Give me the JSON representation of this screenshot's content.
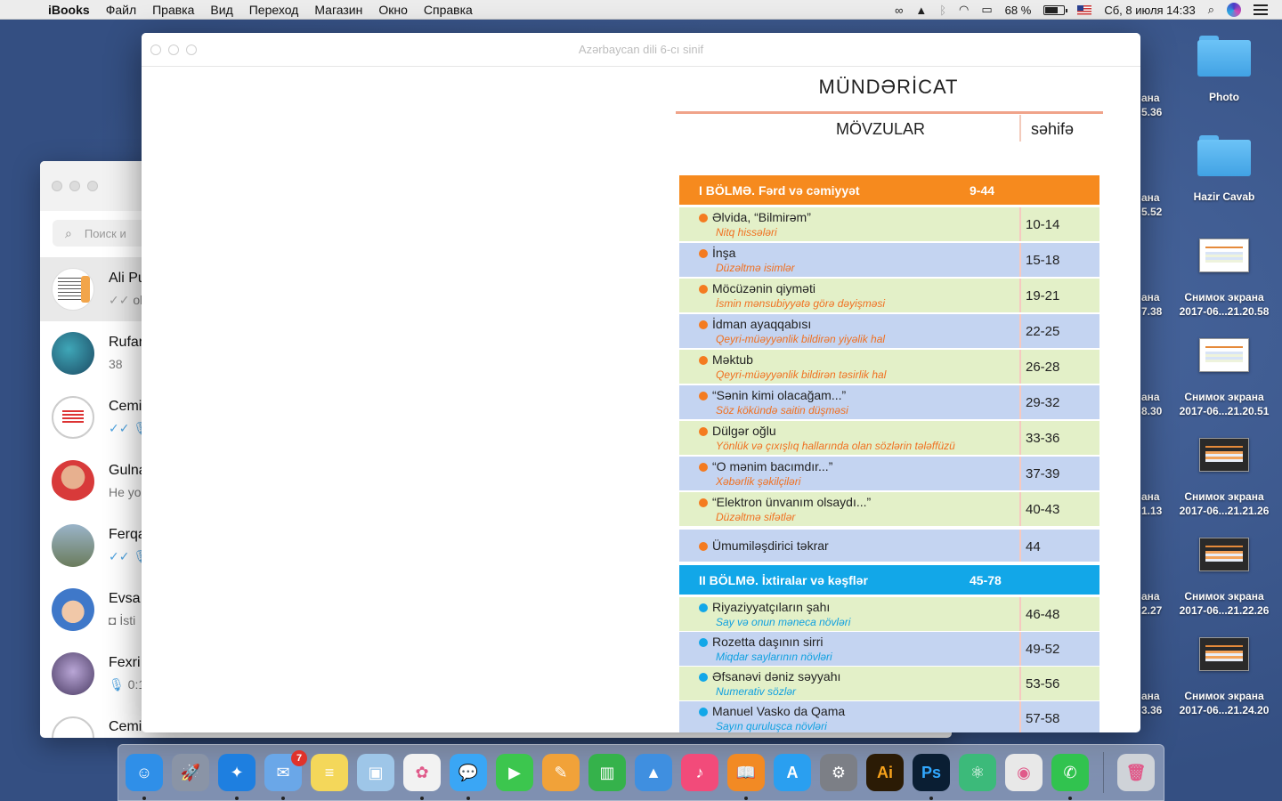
{
  "menubar": {
    "app": "iBooks",
    "items": [
      "Файл",
      "Правка",
      "Вид",
      "Переход",
      "Магазин",
      "Окно",
      "Справка"
    ],
    "battery": "68 %",
    "datetime": "Сб, 8 июля  14:33",
    "battery_level": 0.68
  },
  "desktop": {
    "folders": [
      {
        "label": "Photo"
      },
      {
        "label": "Hazir Cavab"
      }
    ],
    "screenshots": [
      {
        "line1": "Снимок экрана",
        "line2": "2017-06...21.20.58"
      },
      {
        "line1": "Снимок экрана",
        "line2": "2017-06...21.20.51"
      },
      {
        "line1": "Снимок экрана",
        "line2": "2017-06...21.21.26"
      },
      {
        "line1": "Снимок экрана",
        "line2": "2017-06...21.22.26"
      },
      {
        "line1": "Снимок экрана",
        "line2": "2017-06...21.24.20"
      }
    ],
    "cut_labels": [
      {
        "a": "ана",
        "b": "5.36"
      },
      {
        "a": "ана",
        "b": "5.52"
      },
      {
        "a": "ана",
        "b": "7.38"
      },
      {
        "a": "ана",
        "b": "8.30"
      },
      {
        "a": "ана",
        "b": "1.13"
      },
      {
        "a": "ана",
        "b": "2.27"
      },
      {
        "a": "ана",
        "b": "3.36"
      }
    ]
  },
  "messenger": {
    "search_placeholder": "Поиск и",
    "chats": [
      {
        "name": "Ali Pu",
        "preview": "ok"
      },
      {
        "name": "Rufar",
        "preview": "38"
      },
      {
        "name": "Cemi",
        "preview": ""
      },
      {
        "name": "Gulna",
        "preview": "He yo"
      },
      {
        "name": "Ferqa",
        "preview": ""
      },
      {
        "name": "Evsa",
        "preview": "İsti"
      },
      {
        "name": "Fexri",
        "preview": "0:12"
      },
      {
        "name": "Cemi",
        "preview": ""
      }
    ]
  },
  "book": {
    "window_title": "Azərbaycan dili 6-cı sinif",
    "heading": "MÜNDƏRİCAT",
    "col_topics": "MÖVZULAR",
    "col_page": "səhifə",
    "sections": [
      {
        "label": "I BÖLMƏ. Fərd və cəmiyyət",
        "range": "9-44",
        "rows": [
          {
            "topic": "Əlvida, “Bilmirəm”",
            "sub": "Nitq hissələri",
            "pages": "10-14"
          },
          {
            "topic": "İnşa",
            "sub": "Düzəltmə isimlər",
            "pages": "15-18"
          },
          {
            "topic": "Möcüzənin qiyməti",
            "sub": "İsmin mənsubiyyətə görə dəyişməsi",
            "pages": "19-21"
          },
          {
            "topic": "İdman ayaqqabısı",
            "sub": "Qeyri-müəyyənlik bildirən yiyəlik hal",
            "pages": "22-25"
          },
          {
            "topic": "Məktub",
            "sub": "Qeyri-müəyyənlik bildirən təsirlik hal",
            "pages": "26-28"
          },
          {
            "topic": "“Sənin kimi olacağam...”",
            "sub": "Söz kökündə saitin düşməsi",
            "pages": "29-32"
          },
          {
            "topic": "Dülgər oğlu",
            "sub": "Yönlük və çıxışlıq hallarında olan sözlərin tələffüzü",
            "pages": "33-36"
          },
          {
            "topic": "“O mənim bacımdır...”",
            "sub": "Xəbərlik şəkilçiləri",
            "pages": "37-39"
          },
          {
            "topic": "“Elektron ünvanım olsaydı...”",
            "sub": "Düzəltmə sifətlər",
            "pages": "40-43"
          },
          {
            "topic": "Ümumiləşdirici təkrar",
            "sub": "",
            "pages": "44"
          }
        ]
      },
      {
        "label": "II BÖLMƏ. İxtiralar və kəşflər",
        "range": "45-78",
        "rows": [
          {
            "topic": "Riyaziyyatçıların şahı",
            "sub": "Say və onun məneca növləri",
            "pages": "46-48"
          },
          {
            "topic": "Rozetta daşının sirri",
            "sub": "Miqdar saylarının növləri",
            "pages": "49-52"
          },
          {
            "topic": "Əfsanəvi dəniz səyyahı",
            "sub": "Numerativ sözlər",
            "pages": "53-56"
          },
          {
            "topic": "Manuel Vasko da Qama",
            "sub": "Sayın quruluşca növləri",
            "pages": "57-58"
          }
        ]
      }
    ]
  },
  "dock": {
    "apps": [
      {
        "icon": "finder-icon",
        "color": "#2f8fe8"
      },
      {
        "icon": "launchpad-icon",
        "color": "#8a94a6"
      },
      {
        "icon": "safari-icon",
        "color": "#1e7fe0"
      },
      {
        "icon": "mail-icon",
        "color": "#6aa7e8",
        "badge": "7"
      },
      {
        "icon": "notes-icon",
        "color": "#f4d75a"
      },
      {
        "icon": "preview-icon",
        "color": "#9ec6e8"
      },
      {
        "icon": "photos-icon",
        "color": "#f2f2f2"
      },
      {
        "icon": "messages-icon",
        "color": "#3aa6f5"
      },
      {
        "icon": "facetime-icon",
        "color": "#3cc64e"
      },
      {
        "icon": "pages-icon",
        "color": "#f1a239"
      },
      {
        "icon": "numbers-icon",
        "color": "#35b24b"
      },
      {
        "icon": "keynote-icon",
        "color": "#3f8fe0"
      },
      {
        "icon": "itunes-icon",
        "color": "#f24b7a"
      },
      {
        "icon": "ibooks-icon",
        "color": "#f28a24"
      },
      {
        "icon": "appstore-icon",
        "color": "#2a9ff0"
      },
      {
        "icon": "system-preferences-icon",
        "color": "#7c7f86"
      },
      {
        "icon": "illustrator-icon",
        "color": "#2b1b05",
        "text": "Ai"
      },
      {
        "icon": "photoshop-icon",
        "color": "#0a1e33",
        "text": "Ps"
      },
      {
        "icon": "atom-icon",
        "color": "#3cba7a"
      },
      {
        "icon": "color-picker-icon",
        "color": "#e8e8e8"
      },
      {
        "icon": "whatsapp-icon",
        "color": "#31c34f"
      },
      {
        "icon": "trash-icon",
        "color": "#cfd3d8"
      }
    ]
  }
}
